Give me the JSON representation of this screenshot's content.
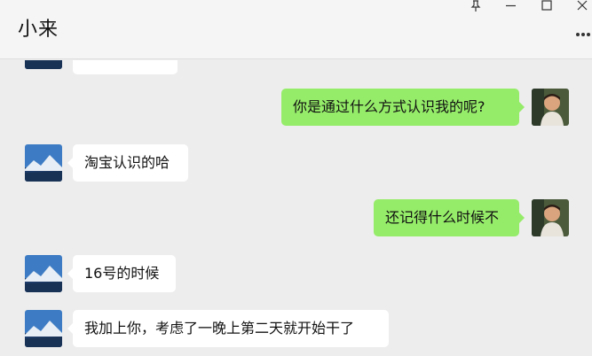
{
  "header": {
    "title": "小来"
  },
  "window_controls": [
    "pin-icon",
    "minimize-icon",
    "maximize-icon",
    "close-icon"
  ],
  "header_actions": [
    "more-icon"
  ],
  "messages": [
    {
      "side": "in",
      "text": ""
    },
    {
      "side": "out",
      "text": "你是通过什么方式认识我的呢?"
    },
    {
      "side": "in",
      "text": "淘宝认识的哈"
    },
    {
      "side": "out",
      "text": "还记得什么时候不"
    },
    {
      "side": "in",
      "text": "16号的时候"
    },
    {
      "side": "in",
      "text": "我加上你，考虑了一晚上第二天就开始干了"
    }
  ],
  "colors": {
    "background": "#ededed",
    "incoming_bubble": "#ffffff",
    "outgoing_bubble": "#95ec69"
  }
}
